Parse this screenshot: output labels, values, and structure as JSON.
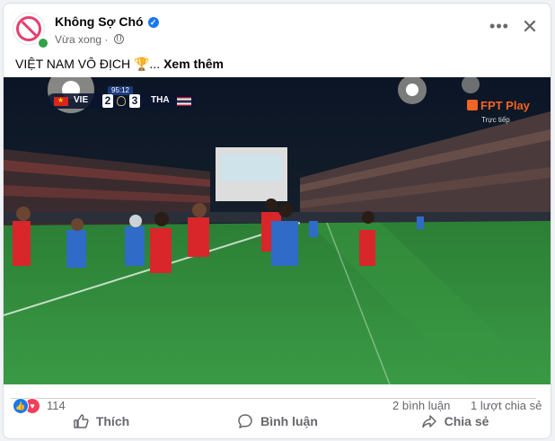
{
  "post": {
    "page_name": "Không Sợ Chó",
    "timestamp": "Vừa xong",
    "separator": "·",
    "caption_text": "VIỆT NAM VÔ ĐỊCH 🏆...",
    "see_more": "Xem thêm"
  },
  "video": {
    "scoreboard": {
      "time": "95:12",
      "home_team": "VIE",
      "home_score": "2",
      "away_score": "3",
      "away_team": "THA"
    },
    "broadcaster": "FPT Play",
    "broadcaster_sub": "Trực tiếp"
  },
  "engagement": {
    "reaction_count": "114",
    "comments": "2 bình luận",
    "shares": "1 lượt chia sẻ"
  },
  "actions": {
    "like": "Thích",
    "comment": "Bình luận",
    "share": "Chia sẻ"
  },
  "colors": {
    "accent": "#1877f2",
    "love": "#f33e58",
    "online": "#31a24c",
    "pitch": "#2f8a3a"
  }
}
